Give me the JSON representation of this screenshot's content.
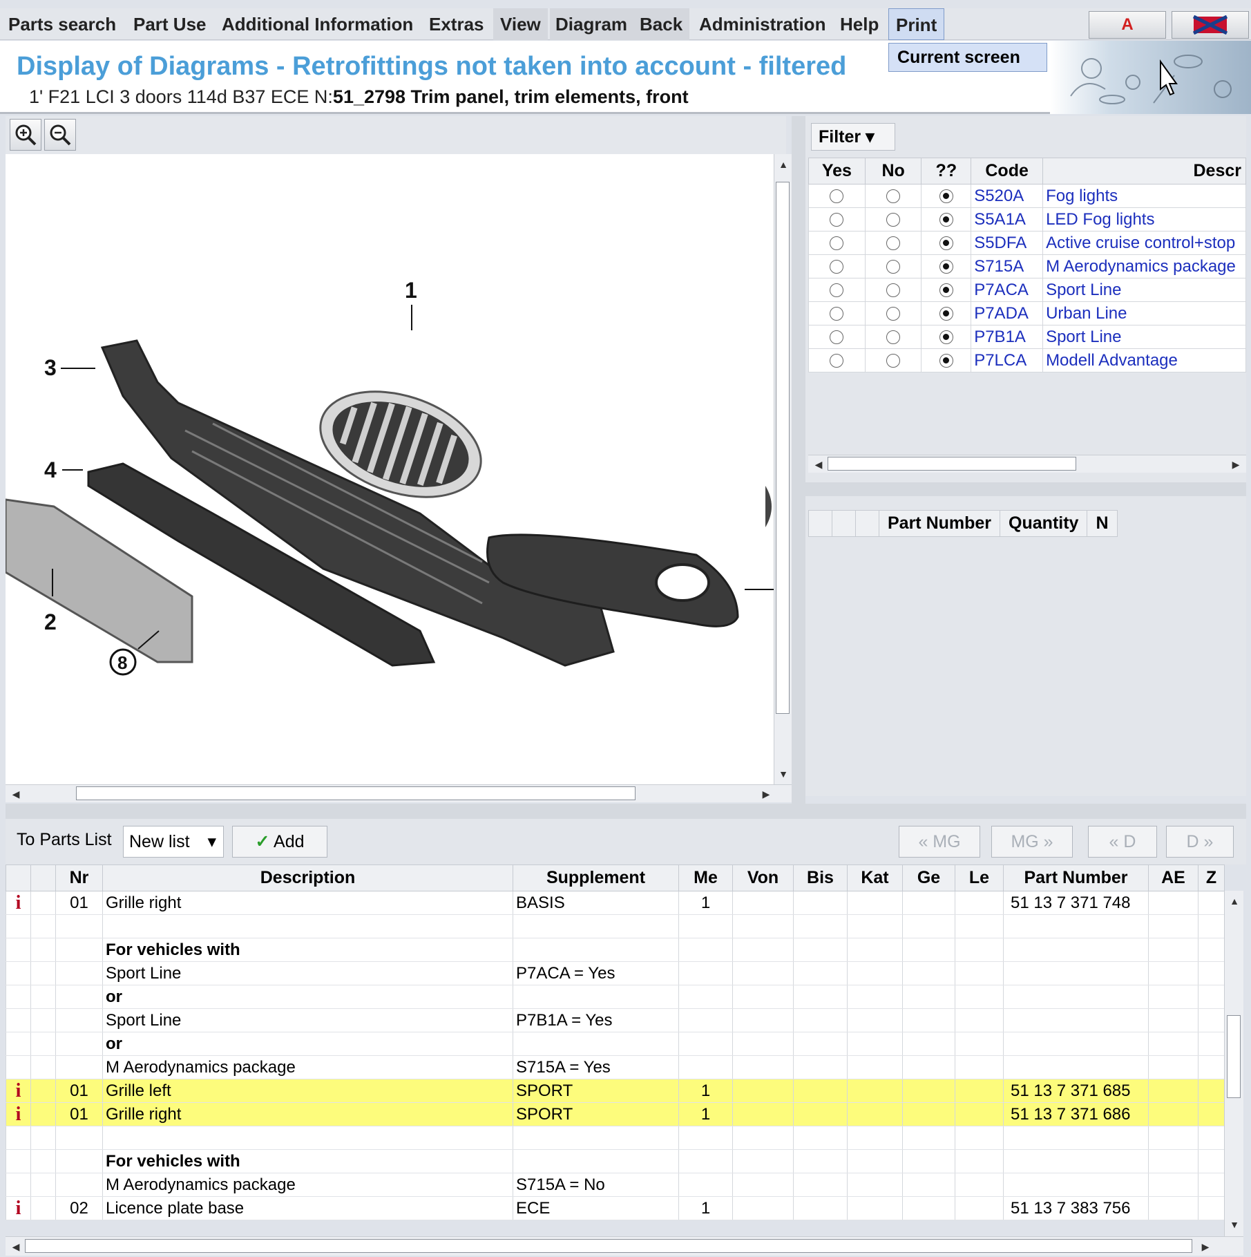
{
  "menu": {
    "items": [
      "Parts search",
      "Part Use",
      "Additional Information",
      "Extras",
      "View",
      "Diagram",
      "Back",
      "Administration",
      "Help",
      "Print"
    ],
    "dropdown": "Current screen"
  },
  "flags": {
    "a": "A",
    "b": ""
  },
  "title": "Display of Diagrams - Retrofittings not taken into account - filtered",
  "subtitle": {
    "model": "1' F21 LCI 3 doors 114d B37 ECE",
    "n_prefix": "N:",
    "group": "51_2798 Trim panel, trim elements, front"
  },
  "diagram": {
    "labels": [
      "1",
      "2",
      "3",
      "4",
      "8"
    ]
  },
  "filter": {
    "button": "Filter",
    "columns": [
      "Yes",
      "No",
      "??",
      "Code",
      "Descr"
    ],
    "rows": [
      {
        "code": "S520A",
        "desc": "Fog lights"
      },
      {
        "code": "S5A1A",
        "desc": "LED Fog lights"
      },
      {
        "code": "S5DFA",
        "desc": "Active cruise control+stop"
      },
      {
        "code": "S715A",
        "desc": "M Aerodynamics package"
      },
      {
        "code": "P7ACA",
        "desc": "Sport Line"
      },
      {
        "code": "P7ADA",
        "desc": "Urban Line"
      },
      {
        "code": "P7B1A",
        "desc": "Sport Line"
      },
      {
        "code": "P7LCA",
        "desc": "Modell Advantage"
      }
    ]
  },
  "partpanel": {
    "columns": [
      "",
      "",
      "",
      "Part Number",
      "Quantity",
      "N"
    ]
  },
  "toolbar": {
    "to_parts_list": "To Parts List",
    "list_value": "New list",
    "add": "Add",
    "mg_prev": "« MG",
    "mg_next": "MG »",
    "d_prev": "« D",
    "d_next": "D »"
  },
  "parts": {
    "columns": [
      "",
      "",
      "Nr",
      "Description",
      "Supplement",
      "Me",
      "Von",
      "Bis",
      "Kat",
      "Ge",
      "Le",
      "Part Number",
      "AE",
      "Z"
    ],
    "rows": [
      {
        "info": "i",
        "nr": "01",
        "desc": "Grille right",
        "supp": "BASIS",
        "me": "1",
        "pn": "51 13 7 371 748",
        "hl": false,
        "bold": false
      },
      {
        "info": "",
        "nr": "",
        "desc": "",
        "supp": "",
        "me": "",
        "pn": "",
        "hl": false,
        "bold": false
      },
      {
        "info": "",
        "nr": "",
        "desc": "For vehicles with",
        "supp": "",
        "me": "",
        "pn": "",
        "hl": false,
        "bold": true
      },
      {
        "info": "",
        "nr": "",
        "desc": "Sport Line",
        "supp": "P7ACA = Yes",
        "me": "",
        "pn": "",
        "hl": false,
        "bold": false
      },
      {
        "info": "",
        "nr": "",
        "desc": "or",
        "supp": "",
        "me": "",
        "pn": "",
        "hl": false,
        "bold": true
      },
      {
        "info": "",
        "nr": "",
        "desc": "Sport Line",
        "supp": "P7B1A = Yes",
        "me": "",
        "pn": "",
        "hl": false,
        "bold": false
      },
      {
        "info": "",
        "nr": "",
        "desc": "or",
        "supp": "",
        "me": "",
        "pn": "",
        "hl": false,
        "bold": true
      },
      {
        "info": "",
        "nr": "",
        "desc": "M Aerodynamics package",
        "supp": "S715A = Yes",
        "me": "",
        "pn": "",
        "hl": false,
        "bold": false
      },
      {
        "info": "i",
        "nr": "01",
        "desc": "Grille left",
        "supp": "SPORT",
        "me": "1",
        "pn": "51 13 7 371 685",
        "hl": true,
        "bold": false
      },
      {
        "info": "i",
        "nr": "01",
        "desc": "Grille right",
        "supp": "SPORT",
        "me": "1",
        "pn": "51 13 7 371 686",
        "hl": true,
        "bold": false
      },
      {
        "info": "",
        "nr": "",
        "desc": "",
        "supp": "",
        "me": "",
        "pn": "",
        "hl": false,
        "bold": false
      },
      {
        "info": "",
        "nr": "",
        "desc": "For vehicles with",
        "supp": "",
        "me": "",
        "pn": "",
        "hl": false,
        "bold": true
      },
      {
        "info": "",
        "nr": "",
        "desc": "M Aerodynamics package",
        "supp": "S715A = No",
        "me": "",
        "pn": "",
        "hl": false,
        "bold": false
      },
      {
        "info": "i",
        "nr": "02",
        "desc": "Licence plate base",
        "supp": "ECE",
        "me": "1",
        "pn": "51 13 7 383 756",
        "hl": false,
        "bold": false
      }
    ]
  },
  "colors": {
    "title": "#4b9ed8",
    "link": "#1c2fbd",
    "highlight": "#fdfc7c",
    "info": "#b2001f"
  }
}
